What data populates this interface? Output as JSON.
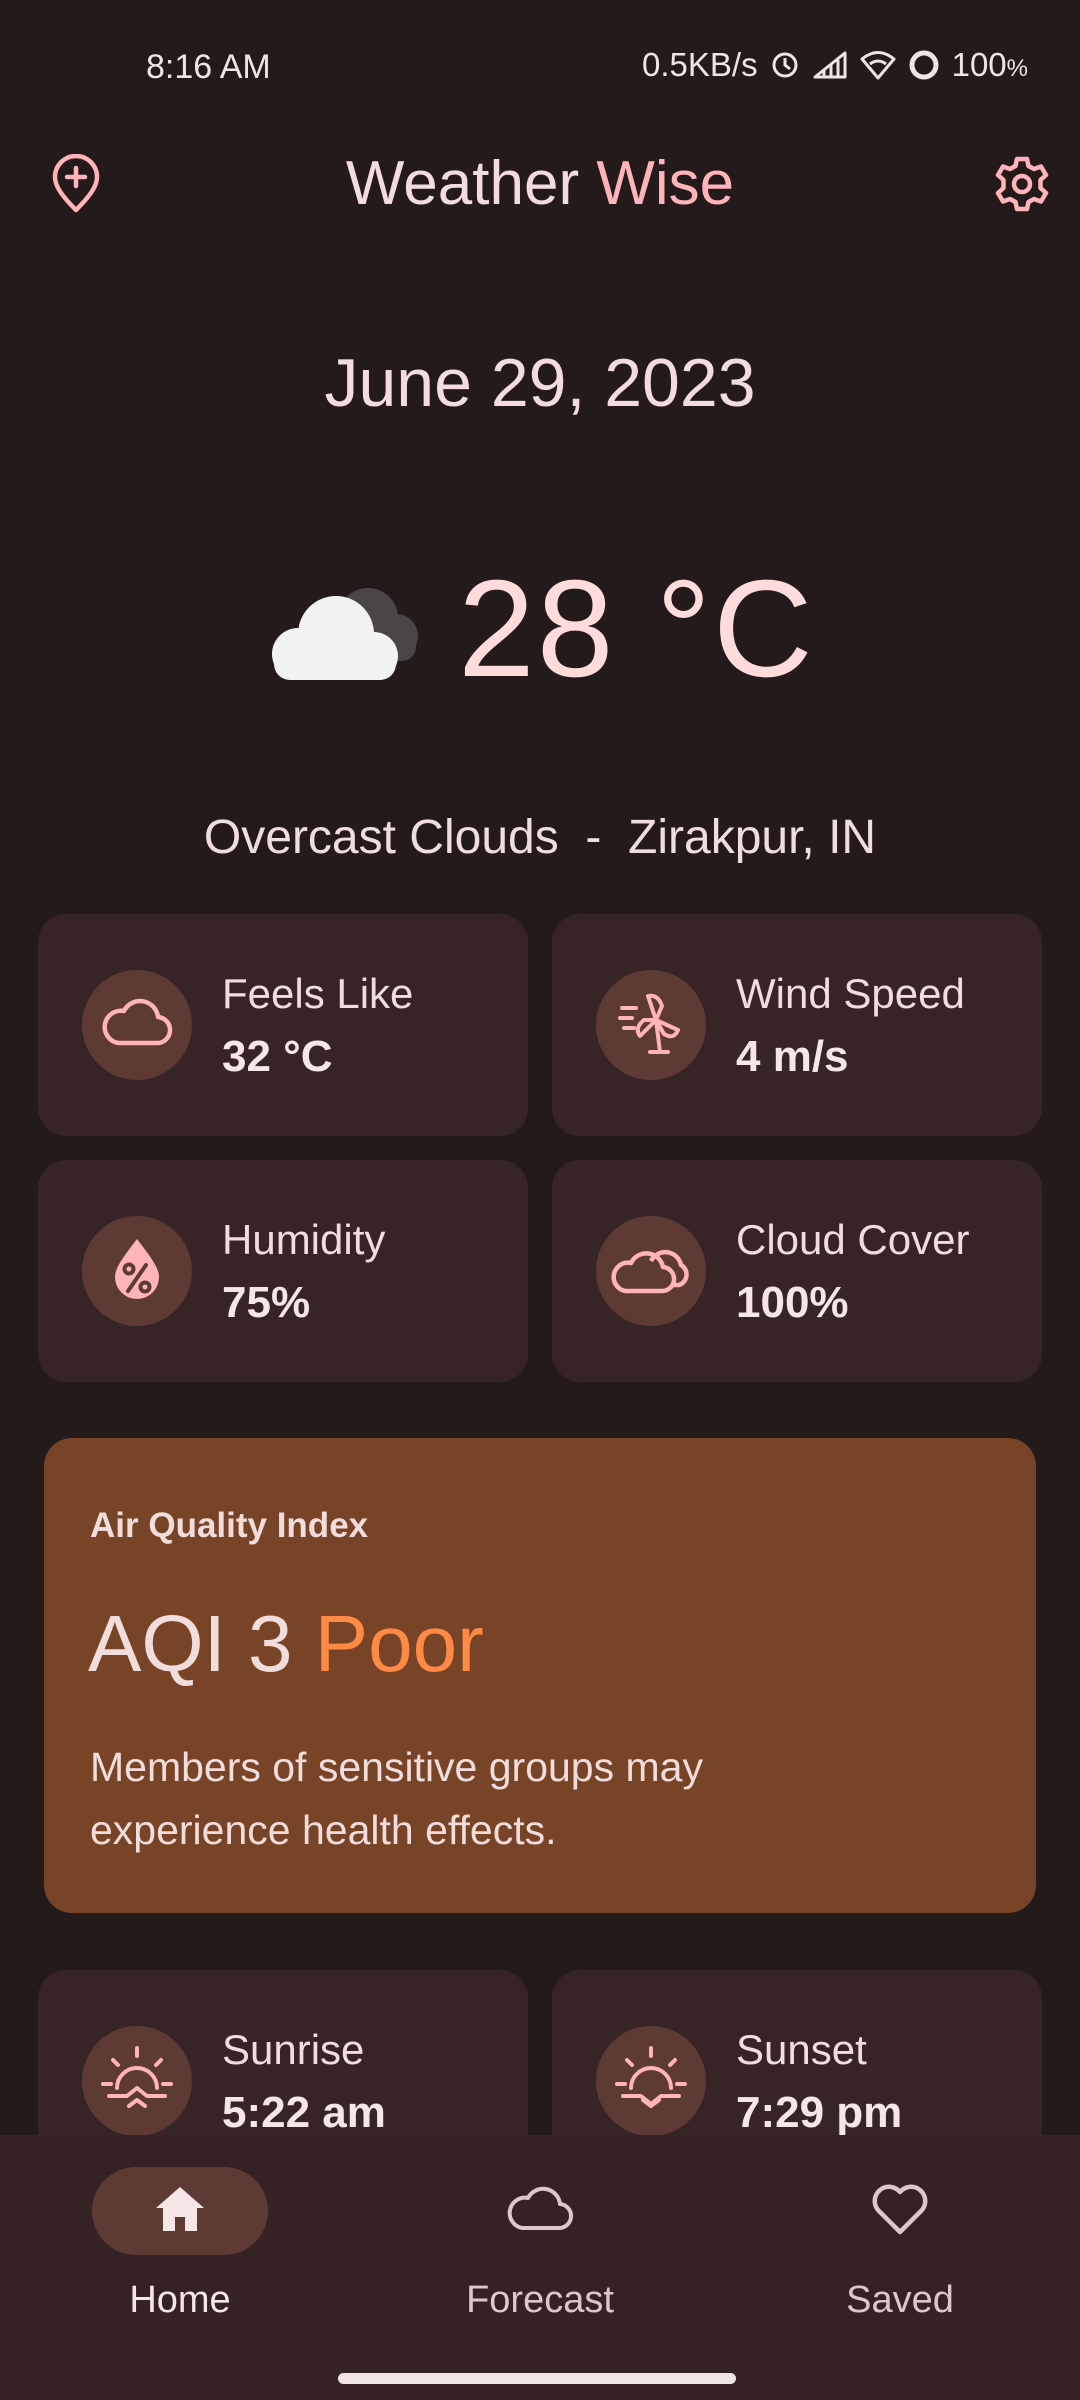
{
  "status_bar": {
    "time": "8:16 AM",
    "network_speed": "0.5KB/s",
    "battery": "100",
    "battery_unit": "%"
  },
  "header": {
    "title_main": "Weather",
    "title_accent": "Wise",
    "left_icon": "add-location-icon",
    "right_icon": "settings-gear-icon"
  },
  "date": "June 29, 2023",
  "current": {
    "temperature": "28 °C",
    "condition_icon": "cloud-icon",
    "condition": "Overcast Clouds",
    "separator": "-",
    "location": "Zirakpur, IN"
  },
  "stats": [
    {
      "label": "Feels Like",
      "value": "32 °C",
      "icon": "cloud-outline-icon"
    },
    {
      "label": "Wind Speed",
      "value": "4 m/s",
      "icon": "wind-turbine-icon"
    },
    {
      "label": "Humidity",
      "value": "75%",
      "icon": "humidity-drop-icon"
    },
    {
      "label": "Cloud Cover",
      "value": "100%",
      "icon": "cloud-cover-icon"
    }
  ],
  "aqi": {
    "heading": "Air Quality Index",
    "index_label": "AQI 3",
    "level": "Poor",
    "description": "Members of sensitive groups may experience health effects."
  },
  "sun": [
    {
      "label": "Sunrise",
      "value": "5:22 am",
      "icon": "sunrise-icon"
    },
    {
      "label": "Sunset",
      "value": "7:29 pm",
      "icon": "sunset-icon"
    }
  ],
  "nav": [
    {
      "label": "Home",
      "icon": "home-icon",
      "active": true
    },
    {
      "label": "Forecast",
      "icon": "cloud-outline-icon",
      "active": false
    },
    {
      "label": "Saved",
      "icon": "heart-icon",
      "active": false
    }
  ],
  "colors": {
    "background": "#251a1a",
    "card": "#372424",
    "icon_circle": "#5e3a34",
    "accent_pink": "#ffb3ba",
    "aqi_card": "#784428",
    "aqi_level": "#ff8a45"
  }
}
